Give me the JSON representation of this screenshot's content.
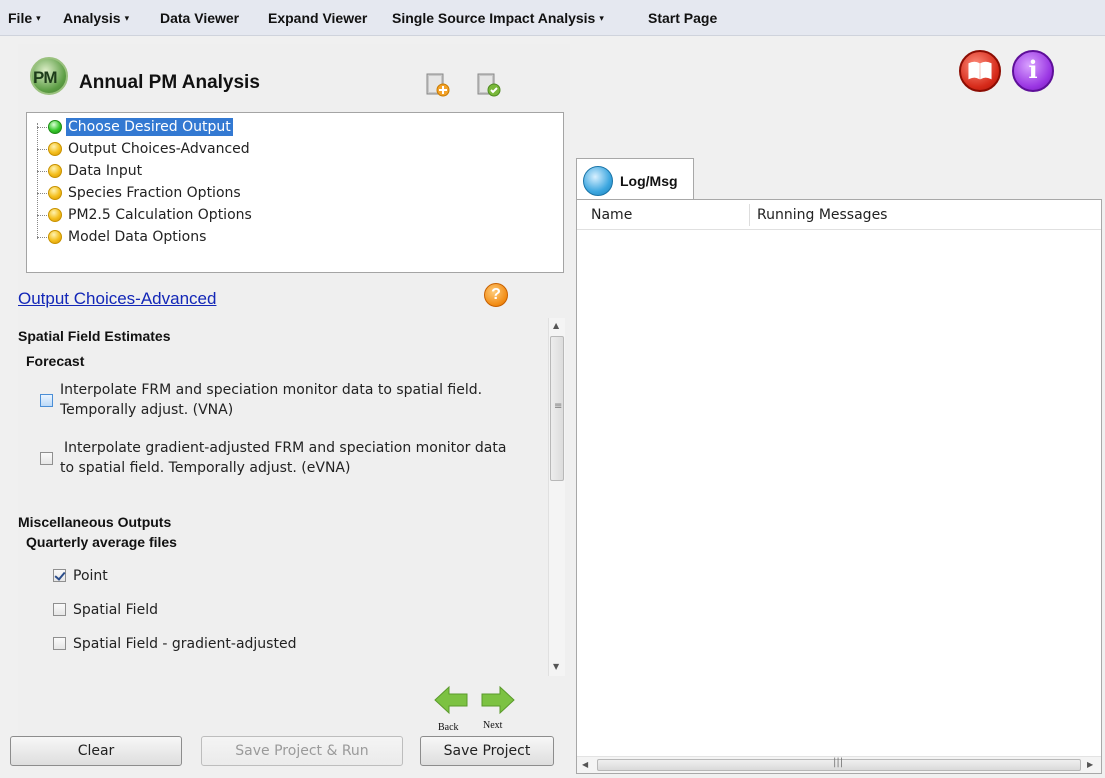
{
  "menubar": {
    "items": [
      {
        "label": "File",
        "caret": "▾"
      },
      {
        "label": "Analysis",
        "caret": "▾"
      },
      {
        "label": "Data Viewer",
        "caret": ""
      },
      {
        "label": "Expand Viewer",
        "caret": ""
      },
      {
        "label": "Single Source Impact Analysis",
        "caret": "▾"
      },
      {
        "label": "Start Page",
        "caret": ""
      }
    ]
  },
  "panel": {
    "logo_text": "PM",
    "title": "Annual PM Analysis",
    "icons": [
      "new-project-icon",
      "open-project-icon"
    ]
  },
  "tree": {
    "items": [
      {
        "label": "Choose Desired Output",
        "status": "active",
        "selected": true
      },
      {
        "label": "Output Choices-Advanced",
        "status": "pending",
        "selected": false
      },
      {
        "label": "Data Input",
        "status": "pending",
        "selected": false
      },
      {
        "label": "Species Fraction Options",
        "status": "pending",
        "selected": false
      },
      {
        "label": "PM2.5 Calculation Options",
        "status": "pending",
        "selected": false
      },
      {
        "label": "Model Data Options",
        "status": "pending",
        "selected": false
      }
    ]
  },
  "section": {
    "title": "Output Choices-Advanced",
    "help_glyph": "?"
  },
  "options": {
    "spatial_heading": "Spatial Field Estimates",
    "forecast_heading": "Forecast",
    "vna_line1": "Interpolate FRM and speciation monitor data to spatial field.",
    "vna_line2": "Temporally adjust. (VNA)",
    "evna_line1": "Interpolate gradient-adjusted FRM and speciation monitor data",
    "evna_line2": "to spatial field. Temporally adjust. (eVNA)",
    "misc_heading": "Miscellaneous Outputs",
    "quarterly_heading": "Quarterly average files",
    "point_label": "Point",
    "point_checked": true,
    "spatial_label": "Spatial Field",
    "spatial_checked": false,
    "spatial_grad_label": "Spatial Field - gradient-adjusted",
    "spatial_grad_checked": false
  },
  "nav": {
    "back_label": "Back",
    "next_label": "Next"
  },
  "buttons": {
    "clear": "Clear",
    "save_run": "Save Project & Run",
    "save": "Save Project"
  },
  "right": {
    "tab_label": "Log/Msg",
    "columns": [
      "Name",
      "Running Messages"
    ],
    "info_glyph": "i"
  },
  "colors": {
    "accent_link": "#1327b7",
    "selection": "#3379d2",
    "nav_arrow": "#7cc242"
  }
}
